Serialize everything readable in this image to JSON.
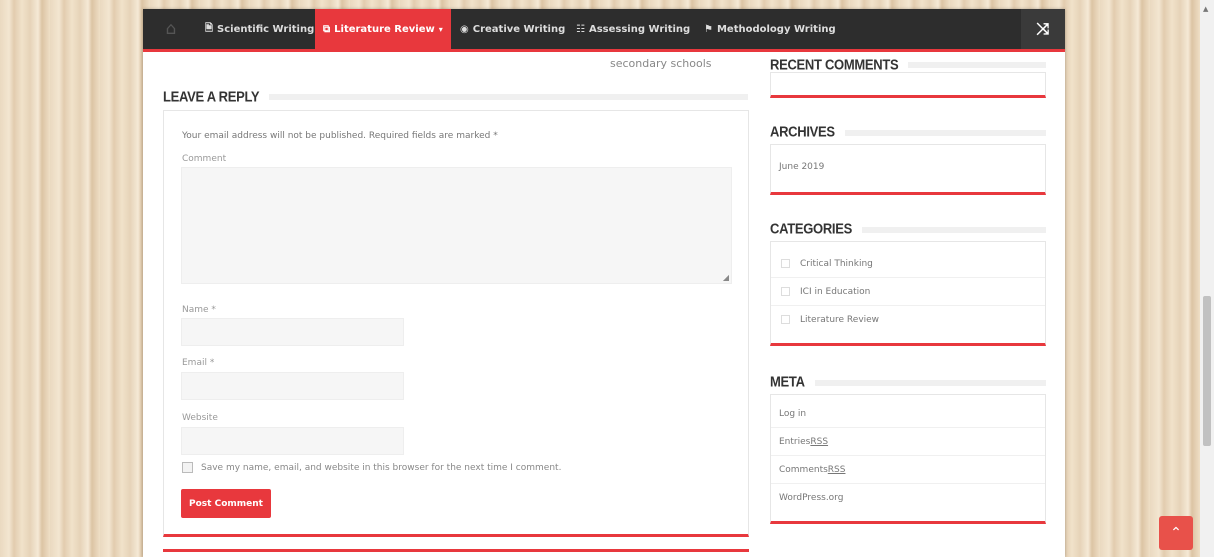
{
  "nav": {
    "home_icon": "home-icon",
    "items": [
      {
        "icon": "doc-icon",
        "glyph": "🗎",
        "label": "Scientific Writing"
      },
      {
        "icon": "copy-icon",
        "glyph": "⧉",
        "label": "Literature Review",
        "active": true,
        "caret": "▾"
      },
      {
        "icon": "eye-icon",
        "glyph": "◉",
        "label": "Creative Writing"
      },
      {
        "icon": "sliders-icon",
        "glyph": "☷",
        "label": "Assessing Writing"
      },
      {
        "icon": "flag-icon",
        "glyph": "⚑",
        "label": "Methodology Writing"
      }
    ],
    "shuffle_icon": "shuffle-icon",
    "accent": "#e8383d"
  },
  "main": {
    "prev_post_text": "secondary schools",
    "reply_title": "LEAVE A REPLY",
    "notice": "Your email address will not be published. Required fields are marked *",
    "comment_label": "Comment",
    "name_label": "Name *",
    "email_label": "Email *",
    "website_label": "Website",
    "cookie_label": "Save my name, email, and website in this browser for the next time I comment.",
    "post_button": "Post Comment"
  },
  "sidebar": {
    "recent_comments_title": "RECENT COMMENTS",
    "archives_title": "ARCHIVES",
    "archives": [
      "June 2019"
    ],
    "categories_title": "CATEGORIES",
    "categories": [
      "Critical Thinking",
      "ICI in Education",
      "Literature Review"
    ],
    "meta_title": "META",
    "meta": [
      {
        "text": "Log in",
        "abbr": ""
      },
      {
        "text": "Entries ",
        "abbr": "RSS"
      },
      {
        "text": "Comments ",
        "abbr": "RSS"
      },
      {
        "text": "WordPress.org",
        "abbr": ""
      }
    ]
  },
  "scroll_top_icon": "chevron-up-icon"
}
